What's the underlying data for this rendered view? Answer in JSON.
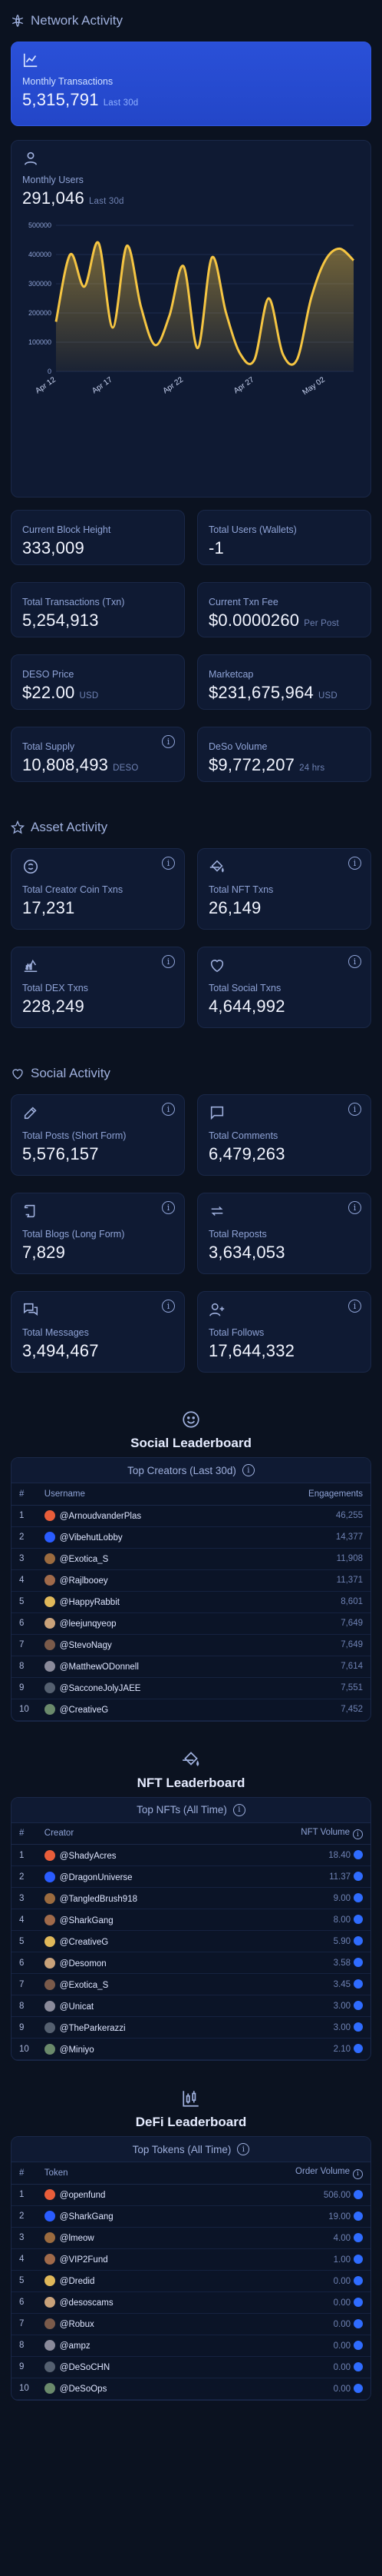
{
  "network": {
    "title": "Network Activity",
    "monthly_transactions": {
      "label": "Monthly Transactions",
      "value": "5,315,791",
      "sub": "Last 30d"
    },
    "monthly_users": {
      "label": "Monthly Users",
      "value": "291,046",
      "sub": "Last 30d"
    }
  },
  "chart_data": {
    "type": "area",
    "x": [
      "Apr 13",
      "Apr 14",
      "Apr 15",
      "Apr 16",
      "Apr 17",
      "Apr 18",
      "Apr 19",
      "Apr 20",
      "Apr 21",
      "Apr 22",
      "Apr 23",
      "Apr 24",
      "Apr 25",
      "Apr 26",
      "Apr 27",
      "Apr 28",
      "Apr 29",
      "Apr 30",
      "May 01",
      "May 02",
      "May 03",
      "May 04"
    ],
    "xticks": [
      "Apr 12",
      "Apr 17",
      "Apr 22",
      "Apr 27",
      "May 02"
    ],
    "y": [
      170000,
      400000,
      290000,
      440000,
      150000,
      430000,
      220000,
      90000,
      190000,
      360000,
      80000,
      390000,
      200000,
      60000,
      40000,
      250000,
      60000,
      40000,
      250000,
      380000,
      420000,
      380000
    ],
    "ylim": [
      0,
      500000
    ],
    "yticks": [
      "500000",
      "400000",
      "300000",
      "200000",
      "100000",
      "0"
    ],
    "color": "#f5c542"
  },
  "stats": [
    {
      "label": "Current Block Height",
      "value": "333,009",
      "sub": ""
    },
    {
      "label": "Total Users (Wallets)",
      "value": "-1",
      "sub": ""
    },
    {
      "label": "Total Transactions (Txn)",
      "value": "5,254,913",
      "sub": ""
    },
    {
      "label": "Current Txn Fee",
      "value": "$0.0000260",
      "sub": "Per Post"
    },
    {
      "label": "DESO Price",
      "value": "$22.00",
      "sub": "USD"
    },
    {
      "label": "Marketcap",
      "value": "$231,675,964",
      "sub": "USD"
    },
    {
      "label": "Total Supply",
      "value": "10,808,493",
      "sub": "DESO"
    },
    {
      "label": "DeSo Volume",
      "value": "$9,772,207",
      "sub": "24 hrs"
    }
  ],
  "asset": {
    "title": "Asset Activity",
    "cards": [
      {
        "label": "Total Creator Coin Txns",
        "value": "17,231"
      },
      {
        "label": "Total NFT Txns",
        "value": "26,149"
      },
      {
        "label": "Total DEX Txns",
        "value": "228,249"
      },
      {
        "label": "Total Social Txns",
        "value": "4,644,992"
      }
    ]
  },
  "social": {
    "title": "Social Activity",
    "cards": [
      {
        "label": "Total Posts (Short Form)",
        "value": "5,576,157"
      },
      {
        "label": "Total Comments",
        "value": "6,479,263"
      },
      {
        "label": "Total Blogs (Long Form)",
        "value": "7,829"
      },
      {
        "label": "Total Reposts",
        "value": "3,634,053"
      },
      {
        "label": "Total Messages",
        "value": "3,494,467"
      },
      {
        "label": "Total Follows",
        "value": "17,644,332"
      }
    ]
  },
  "social_lb": {
    "title": "Social Leaderboard",
    "caption": "Top Creators (Last 30d)",
    "col_rank": "#",
    "col_user": "Username",
    "col_val": "Engagements",
    "rows": [
      {
        "rank": "1",
        "name": "@ArnoudvanderPlas",
        "value": "46,255"
      },
      {
        "rank": "2",
        "name": "@VibehutLobby",
        "value": "14,377"
      },
      {
        "rank": "3",
        "name": "@Exotica_S",
        "value": "11,908"
      },
      {
        "rank": "4",
        "name": "@Rajlbooey",
        "value": "11,371"
      },
      {
        "rank": "5",
        "name": "@HappyRabbit",
        "value": "8,601"
      },
      {
        "rank": "6",
        "name": "@leejunqyeop",
        "value": "7,649"
      },
      {
        "rank": "7",
        "name": "@StevoNagy",
        "value": "7,649"
      },
      {
        "rank": "8",
        "name": "@MatthewODonnell",
        "value": "7,614"
      },
      {
        "rank": "9",
        "name": "@SacconeJolyJAEE",
        "value": "7,551"
      },
      {
        "rank": "10",
        "name": "@CreativeG",
        "value": "7,452"
      }
    ]
  },
  "nft_lb": {
    "title": "NFT Leaderboard",
    "caption": "Top NFTs (All Time)",
    "col_rank": "#",
    "col_user": "Creator",
    "col_val": "NFT Volume",
    "rows": [
      {
        "rank": "1",
        "name": "@ShadyAcres",
        "value": "18.40"
      },
      {
        "rank": "2",
        "name": "@DragonUniverse",
        "value": "11.37"
      },
      {
        "rank": "3",
        "name": "@TangledBrush918",
        "value": "9.00"
      },
      {
        "rank": "4",
        "name": "@SharkGang",
        "value": "8.00"
      },
      {
        "rank": "5",
        "name": "@CreativeG",
        "value": "5.90"
      },
      {
        "rank": "6",
        "name": "@Desomon",
        "value": "3.58"
      },
      {
        "rank": "7",
        "name": "@Exotica_S",
        "value": "3.45"
      },
      {
        "rank": "8",
        "name": "@Unicat",
        "value": "3.00"
      },
      {
        "rank": "9",
        "name": "@TheParkerazzi",
        "value": "3.00"
      },
      {
        "rank": "10",
        "name": "@Miniyo",
        "value": "2.10"
      }
    ]
  },
  "defi_lb": {
    "title": "DeFi Leaderboard",
    "caption": "Top Tokens (All Time)",
    "col_rank": "#",
    "col_user": "Token",
    "col_val": "Order Volume",
    "rows": [
      {
        "rank": "1",
        "name": "@openfund",
        "value": "506.00"
      },
      {
        "rank": "2",
        "name": "@SharkGang",
        "value": "19.00"
      },
      {
        "rank": "3",
        "name": "@lmeow",
        "value": "4.00"
      },
      {
        "rank": "4",
        "name": "@VIP2Fund",
        "value": "1.00"
      },
      {
        "rank": "5",
        "name": "@Dredid",
        "value": "0.00"
      },
      {
        "rank": "6",
        "name": "@desoscams",
        "value": "0.00"
      },
      {
        "rank": "7",
        "name": "@Robux",
        "value": "0.00"
      },
      {
        "rank": "8",
        "name": "@ampz",
        "value": "0.00"
      },
      {
        "rank": "9",
        "name": "@DeSoCHN",
        "value": "0.00"
      },
      {
        "rank": "10",
        "name": "@DeSoOps",
        "value": "0.00"
      }
    ]
  }
}
